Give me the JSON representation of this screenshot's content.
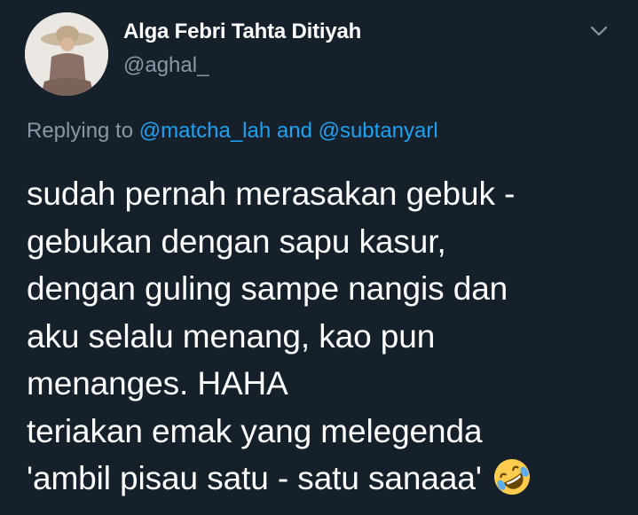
{
  "tweet": {
    "author_name": "Alga Febri Tahta Ditiyah",
    "author_handle": "@aghal_",
    "reply": {
      "prefix": "Replying to",
      "mention1": "@matcha_lah",
      "conjunction": "and",
      "mention2": "@subtanyarl"
    },
    "lines": [
      "sudah pernah merasakan gebuk -",
      "gebukan dengan sapu kasur,",
      "dengan guling sampe nangis dan",
      "aku selalu menang, kao pun",
      "menanges. HAHA",
      "teriakan emak yang melegenda",
      "'ambil pisau satu - satu sanaaa'"
    ],
    "emoji": "rolling-on-the-floor-laughing-emoji"
  },
  "colors": {
    "background": "#15202b",
    "text": "#ffffff",
    "secondary": "#8899a6",
    "link": "#1da1f2"
  }
}
